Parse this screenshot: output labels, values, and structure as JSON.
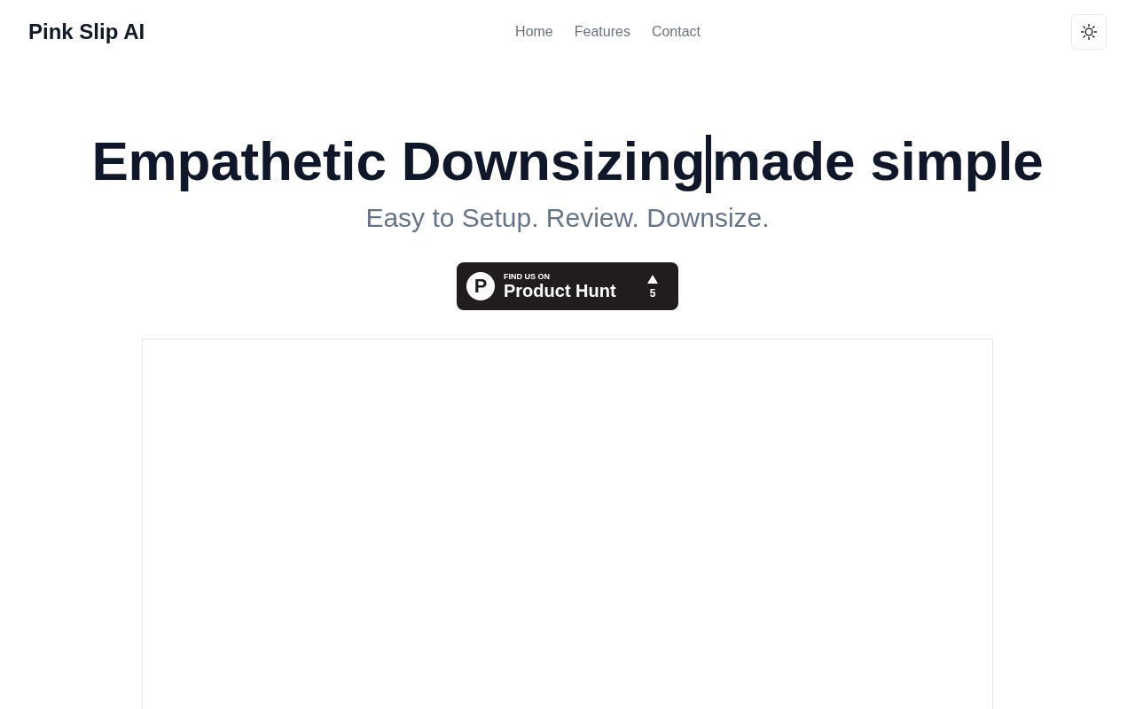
{
  "header": {
    "brand": "Pink Slip AI",
    "nav": [
      {
        "label": "Home"
      },
      {
        "label": "Features"
      },
      {
        "label": "Contact"
      }
    ]
  },
  "hero": {
    "title": "Empathetic Downsizing",
    "typed_text": "made simple",
    "subtitle": "Easy to Setup. Review. Downsize.",
    "badge": {
      "logo_letter": "P",
      "caption": "FIND US ON",
      "name": "Product Hunt",
      "votes": "5"
    }
  }
}
